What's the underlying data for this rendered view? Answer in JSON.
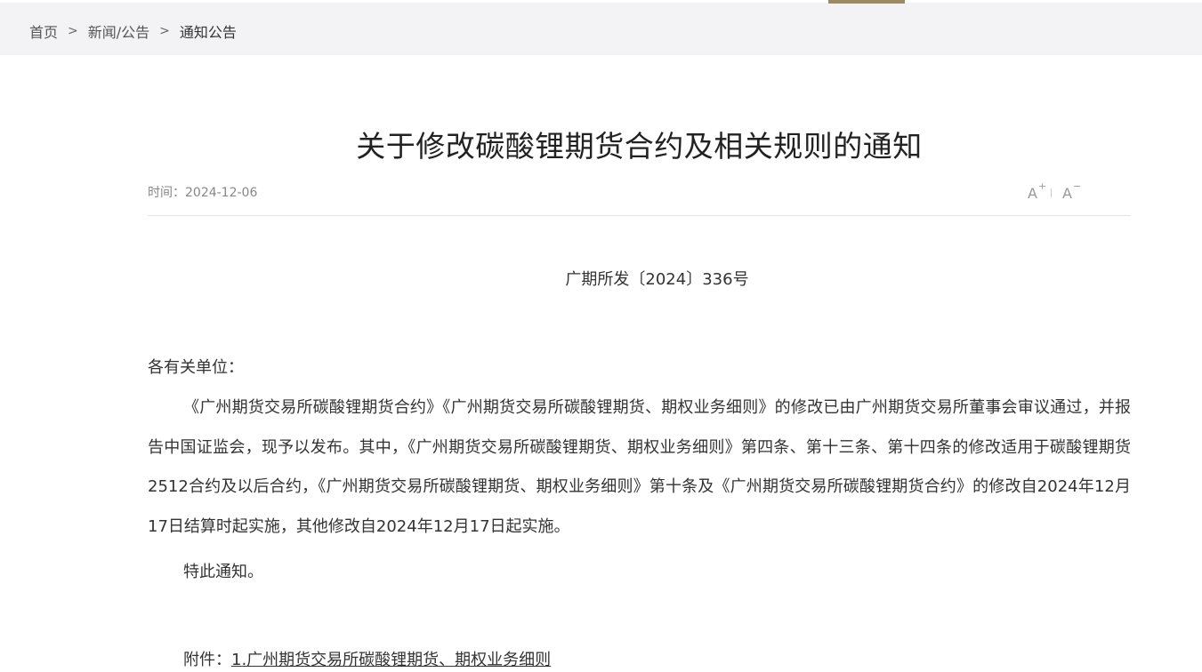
{
  "breadcrumb": {
    "items": [
      "首页",
      "新闻/公告",
      "通知公告"
    ],
    "separator": ">"
  },
  "article": {
    "title": "关于修改碳酸锂期货合约及相关规则的通知",
    "date_label": "时间：",
    "date": "2024-12-06",
    "font_controls": {
      "increase": "A",
      "increase_sup": "+",
      "decrease": "A",
      "decrease_sup": "−"
    },
    "doc_number": "广期所发〔2024〕336号",
    "salutation": "各有关单位：",
    "body": "《广州期货交易所碳酸锂期货合约》《广州期货交易所碳酸锂期货、期权业务细则》的修改已由广州期货交易所董事会审议通过，并报告中国证监会，现予以发布。其中，《广州期货交易所碳酸锂期货、期权业务细则》第四条、第十三条、第十四条的修改适用于碳酸锂期货2512合约及以后合约，《广州期货交易所碳酸锂期货、期权业务细则》第十条及《广州期货交易所碳酸锂期货合约》的修改自2024年12月17日结算时起实施，其他修改自2024年12月17日起实施。",
    "closing": "特此通知。",
    "attachment_label": "附件：",
    "attachment_link": "1.广州期货交易所碳酸锂期货、期权业务细则"
  },
  "colors": {
    "accent": "#9c8a63",
    "topbar_bg": "#f3f3f5",
    "rule": "#e3e3e3"
  }
}
